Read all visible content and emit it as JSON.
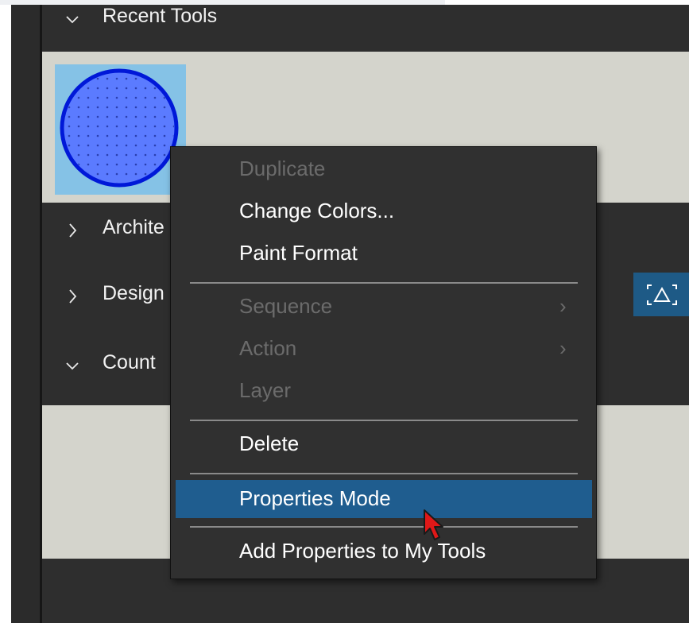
{
  "panel": {
    "sections": [
      {
        "label": "Recent Tools",
        "expanded": true,
        "chevron": "chevron-down-icon"
      },
      {
        "label": "Archite",
        "expanded": false,
        "chevron": "chevron-right-icon"
      },
      {
        "label": "Design",
        "expanded": false,
        "chevron": "chevron-right-icon"
      },
      {
        "label": "Count",
        "expanded": true,
        "chevron": "chevron-down-icon"
      }
    ],
    "recent_tools": [
      {
        "name": "circle-tool-icon",
        "fill_color": "#5b7bff",
        "stroke_color": "#0018d8",
        "tile_color": "#85c2e6"
      }
    ],
    "fit_icon": "fit-to-screen-icon"
  },
  "context_menu": {
    "items": [
      {
        "label": "Duplicate",
        "enabled": false
      },
      {
        "label": "Change Colors...",
        "enabled": true
      },
      {
        "label": "Paint Format",
        "enabled": true
      },
      {
        "label": "Sequence",
        "enabled": false,
        "submenu": true
      },
      {
        "label": "Action",
        "enabled": false,
        "submenu": true
      },
      {
        "label": "Layer",
        "enabled": false
      },
      {
        "label": "Delete",
        "enabled": true
      },
      {
        "label": "Properties Mode",
        "enabled": true,
        "highlighted": true
      },
      {
        "label": "Add Properties to My Tools",
        "enabled": true
      }
    ],
    "submenu_glyph": "›"
  },
  "colors": {
    "panel_bg": "#2e2e2e",
    "content_bg": "#d4d4cc",
    "menu_bg": "#303030",
    "menu_highlight": "#1f5d8f",
    "disabled_text": "#6b6b6b",
    "cursor_red": "#e01818"
  }
}
